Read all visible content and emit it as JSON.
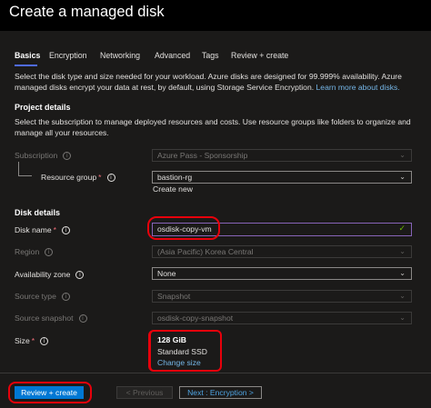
{
  "title": "Create a managed disk",
  "tabs": [
    "Basics",
    "Encryption",
    "Networking",
    "Advanced",
    "Tags",
    "Review + create"
  ],
  "intro": {
    "text": "Select the disk type and size needed for your workload. Azure disks are designed for 99.999% availability. Azure managed disks encrypt your data at rest, by default, using Storage Service Encryption.",
    "link": "Learn more about disks."
  },
  "project": {
    "heading": "Project details",
    "text": "Select the subscription to manage deployed resources and costs. Use resource groups like folders to organize and manage all your resources.",
    "subscription_label": "Subscription",
    "subscription_value": "Azure Pass - Sponsorship",
    "rg_label": "Resource group",
    "rg_value": "bastion-rg",
    "create_new": "Create new"
  },
  "disk": {
    "heading": "Disk details",
    "name_label": "Disk name",
    "name_value": "osdisk-copy-vm",
    "region_label": "Region",
    "region_value": "(Asia Pacific) Korea Central",
    "az_label": "Availability zone",
    "az_value": "None",
    "source_type_label": "Source type",
    "source_type_value": "Snapshot",
    "source_snapshot_label": "Source snapshot",
    "source_snapshot_value": "osdisk-copy-snapshot",
    "size_label": "Size",
    "size_value": "128 GiB",
    "size_sku": "Standard SSD",
    "change_size": "Change size"
  },
  "footer": {
    "review": "Review + create",
    "previous": "< Previous",
    "next": "Next : Encryption >"
  },
  "colors": {
    "background": "#1b1a19",
    "accent": "#0078d4",
    "link": "#75b6e7",
    "annotation": "#e8000b"
  }
}
